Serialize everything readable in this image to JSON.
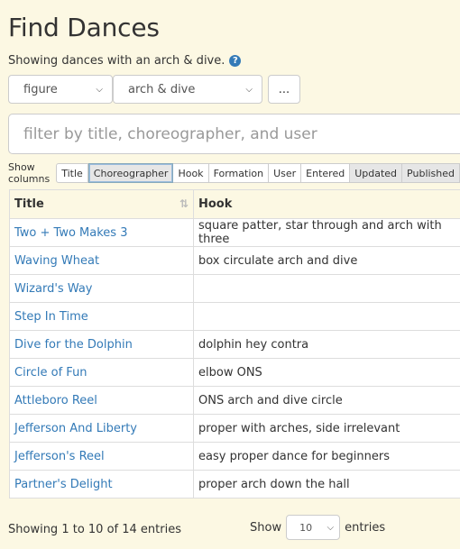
{
  "header": {
    "title": "Find Dances",
    "subtitle": "Showing dances with an arch & dive.",
    "help_icon": "?"
  },
  "query": {
    "figure_select": "figure",
    "arch_select": "arch & dive",
    "more_label": "...",
    "filter_placeholder": "filter by title, choreographer, and user"
  },
  "columns_bar": {
    "label": "Show columns",
    "buttons": [
      {
        "label": "Title"
      },
      {
        "label": "Choreographer"
      },
      {
        "label": "Hook"
      },
      {
        "label": "Formation"
      },
      {
        "label": "User"
      },
      {
        "label": "Entered"
      },
      {
        "label": "Updated"
      },
      {
        "label": "Published"
      }
    ]
  },
  "table": {
    "headers": [
      "Title",
      "Hook"
    ],
    "sort_icon": "⇅",
    "rows": [
      {
        "title": "Two + Two Makes 3",
        "hook": "square patter, star through and arch with three"
      },
      {
        "title": "Waving Wheat",
        "hook": "box circulate arch and dive"
      },
      {
        "title": "Wizard's Way",
        "hook": ""
      },
      {
        "title": "Step In Time",
        "hook": ""
      },
      {
        "title": "Dive for the Dolphin",
        "hook": "dolphin hey contra"
      },
      {
        "title": "Circle of Fun",
        "hook": "elbow ONS"
      },
      {
        "title": "Attleboro Reel",
        "hook": "ONS arch and dive circle"
      },
      {
        "title": "Jefferson And Liberty",
        "hook": "proper with arches, side irrelevant"
      },
      {
        "title": "Jefferson's Reel",
        "hook": "easy proper dance for beginners"
      },
      {
        "title": "Partner's Delight",
        "hook": "proper arch down the hall"
      }
    ]
  },
  "footer": {
    "info": "Showing 1 to 10 of 14 entries",
    "show_label": "Show",
    "page_length": "10",
    "entries_label": "entries"
  },
  "colors": {
    "background": "#fcf8e3",
    "link": "#337ab7"
  }
}
